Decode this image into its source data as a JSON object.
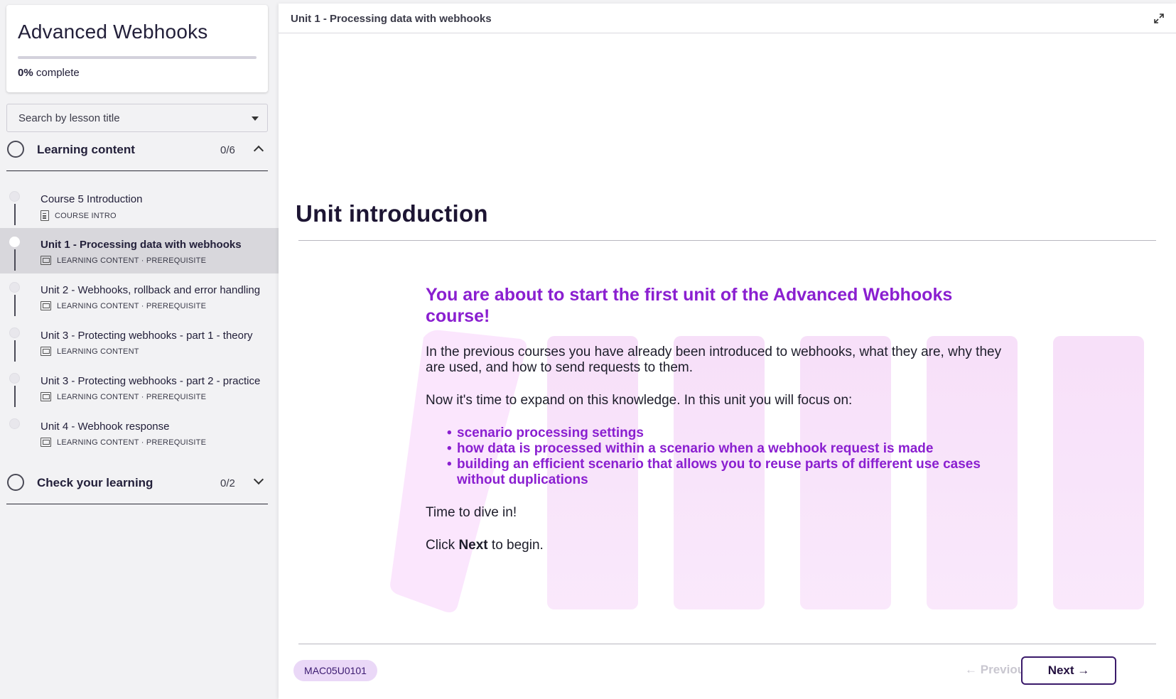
{
  "sidebar": {
    "course_title": "Advanced Webhooks",
    "progress": {
      "percent_label": "0%",
      "suffix": "complete",
      "fraction": 0
    },
    "search_placeholder": "Search by lesson title",
    "sections": [
      {
        "title": "Learning content",
        "count": "0/6",
        "expanded": true
      },
      {
        "title": "Check your learning",
        "count": "0/2",
        "expanded": false
      }
    ],
    "lessons": [
      {
        "title": "Course 5 Introduction",
        "meta": "COURSE INTRO",
        "icon": "document-icon",
        "active": false
      },
      {
        "title": "Unit 1 - Processing data with webhooks",
        "meta": "LEARNING CONTENT · PREREQUISITE",
        "icon": "slides-icon",
        "active": true
      },
      {
        "title": "Unit 2 - Webhooks, rollback and error handling",
        "meta": "LEARNING CONTENT · PREREQUISITE",
        "icon": "slides-icon",
        "active": false
      },
      {
        "title": "Unit 3 - Protecting webhooks - part 1 - theory",
        "meta": "LEARNING CONTENT",
        "icon": "slides-icon",
        "active": false
      },
      {
        "title": "Unit 3 - Protecting webhooks - part 2 - practice",
        "meta": "LEARNING CONTENT · PREREQUISITE",
        "icon": "slides-icon",
        "active": false
      },
      {
        "title": "Unit 4 - Webhook response",
        "meta": "LEARNING CONTENT · PREREQUISITE",
        "icon": "slides-icon",
        "active": false
      }
    ]
  },
  "main": {
    "topbar_title": "Unit 1 - Processing data with webhooks",
    "heading": "Unit introduction",
    "content": {
      "headline": "You are about to start the first unit of the Advanced Webhooks course!",
      "p1": "In the previous courses you have already been introduced to webhooks, what they are, why they are used, and how to send requests to them.",
      "p2": "Now it's time to expand on this knowledge. In this unit you will focus on:",
      "bullets": [
        "scenario processing settings",
        "how data is processed within a scenario when a webhook request is made",
        "building an efficient scenario that allows you to reuse parts of different use cases without duplications"
      ],
      "p3": "Time to dive in!",
      "p4_before": "Click ",
      "p4_bold": "Next",
      "p4_after": " to begin."
    },
    "footer": {
      "code": "MAC05U0101",
      "previous_label": "Previous",
      "next_label": "Next"
    }
  },
  "colors": {
    "accent_purple": "#8a1fd0",
    "dark_purple": "#3a1a6a",
    "badge_bg": "#ead8f7"
  }
}
